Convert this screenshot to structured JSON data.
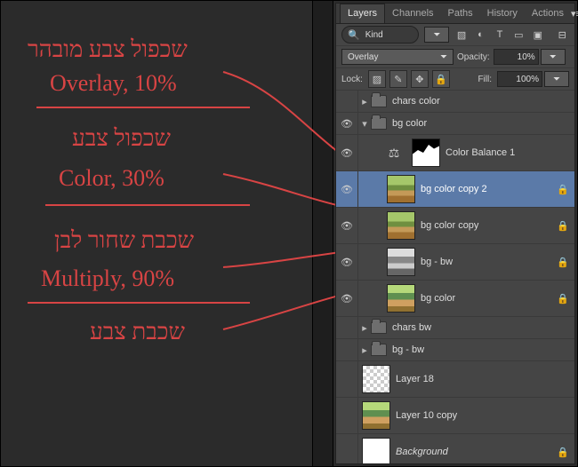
{
  "panel": {
    "tabs": [
      "Layers",
      "Channels",
      "Paths",
      "History",
      "Actions"
    ],
    "active_tab": "Layers",
    "filter": {
      "search_label": "Kind",
      "icons": [
        "image-filter-icon",
        "adjustment-filter-icon",
        "type-filter-icon",
        "shape-filter-icon",
        "smartobj-filter-icon"
      ]
    },
    "blend_mode": "Overlay",
    "opacity_label": "Opacity:",
    "opacity_value": "10%",
    "lock_label": "Lock:",
    "fill_label": "Fill:",
    "fill_value": "100%"
  },
  "layers": [
    {
      "type": "folder",
      "name": "chars color",
      "expanded": false,
      "visible": false,
      "indent": 0
    },
    {
      "type": "folder",
      "name": "bg color",
      "expanded": true,
      "visible": true,
      "indent": 0
    },
    {
      "type": "adjust",
      "name": "Color Balance 1",
      "visible": true,
      "indent": 2
    },
    {
      "type": "raster",
      "name": "bg color copy 2",
      "visible": true,
      "indent": 2,
      "thumb": "landscape",
      "locked": true,
      "selected": true
    },
    {
      "type": "raster",
      "name": "bg color copy",
      "visible": true,
      "indent": 2,
      "thumb": "landscape",
      "locked": true
    },
    {
      "type": "raster",
      "name": "bg - bw",
      "visible": true,
      "indent": 2,
      "thumb": "bw",
      "locked": true
    },
    {
      "type": "raster",
      "name": "bg color",
      "visible": true,
      "indent": 2,
      "thumb": "landscape2",
      "locked": true
    },
    {
      "type": "folder",
      "name": "chars bw",
      "expanded": false,
      "visible": false,
      "indent": 0
    },
    {
      "type": "folder",
      "name": "bg - bw",
      "expanded": false,
      "visible": false,
      "indent": 0
    },
    {
      "type": "raster",
      "name": "Layer 18",
      "visible": false,
      "indent": 0,
      "thumb": "checker"
    },
    {
      "type": "raster",
      "name": "Layer 10 copy",
      "visible": false,
      "indent": 0,
      "thumb": "landscape2"
    },
    {
      "type": "raster",
      "name": "Background",
      "visible": false,
      "indent": 0,
      "thumb": "white",
      "locked": true,
      "italic": true
    }
  ],
  "annotations": {
    "l1a": "שכפול צבע מובהר",
    "l1b": "Overlay, 10%",
    "l2a": "שכפול צבע",
    "l2b": "Color, 30%",
    "l3a": "שכבת שחור לבן",
    "l3b": "Multiply, 90%",
    "l4a": "שכבת צבע"
  }
}
